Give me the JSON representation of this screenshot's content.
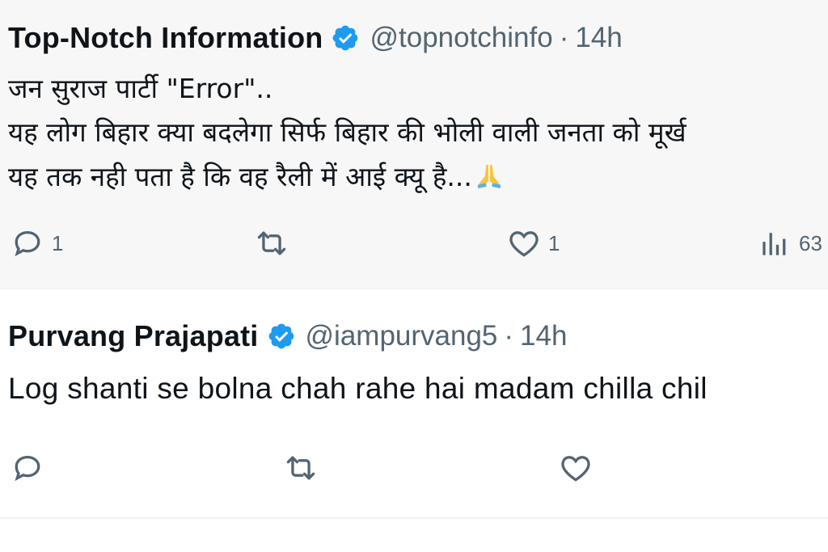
{
  "tweets": [
    {
      "author_name": "Top-Notch Information",
      "handle": "@topnotchinfo",
      "separator": "·",
      "time": "14h",
      "lines": [
        "जन सुराज पार्टी \"Error\"..",
        "यह लोग बिहार क्या बदलेगा सिर्फ बिहार की भोली वाली जनता को मूर्ख",
        "यह तक नही पता है कि वह रैली में आई क्यू है..."
      ],
      "emoji": "folded-hands",
      "actions": {
        "reply_count": "1",
        "retweet_count": "",
        "like_count": "1",
        "views_count": "63"
      }
    },
    {
      "author_name": "Purvang Prajapati",
      "handle": "@iampurvang5",
      "separator": "·",
      "time": "14h",
      "lines": [
        "Log shanti se bolna chah rahe hai madam chilla chil"
      ],
      "actions": {
        "reply_count": "",
        "retweet_count": "",
        "like_count": ""
      }
    }
  ],
  "colors": {
    "verified_blue": "#1d9bf0",
    "secondary_text": "#536471",
    "primary_text": "#0f1419",
    "highlight_bg": "#f7f7f7"
  }
}
